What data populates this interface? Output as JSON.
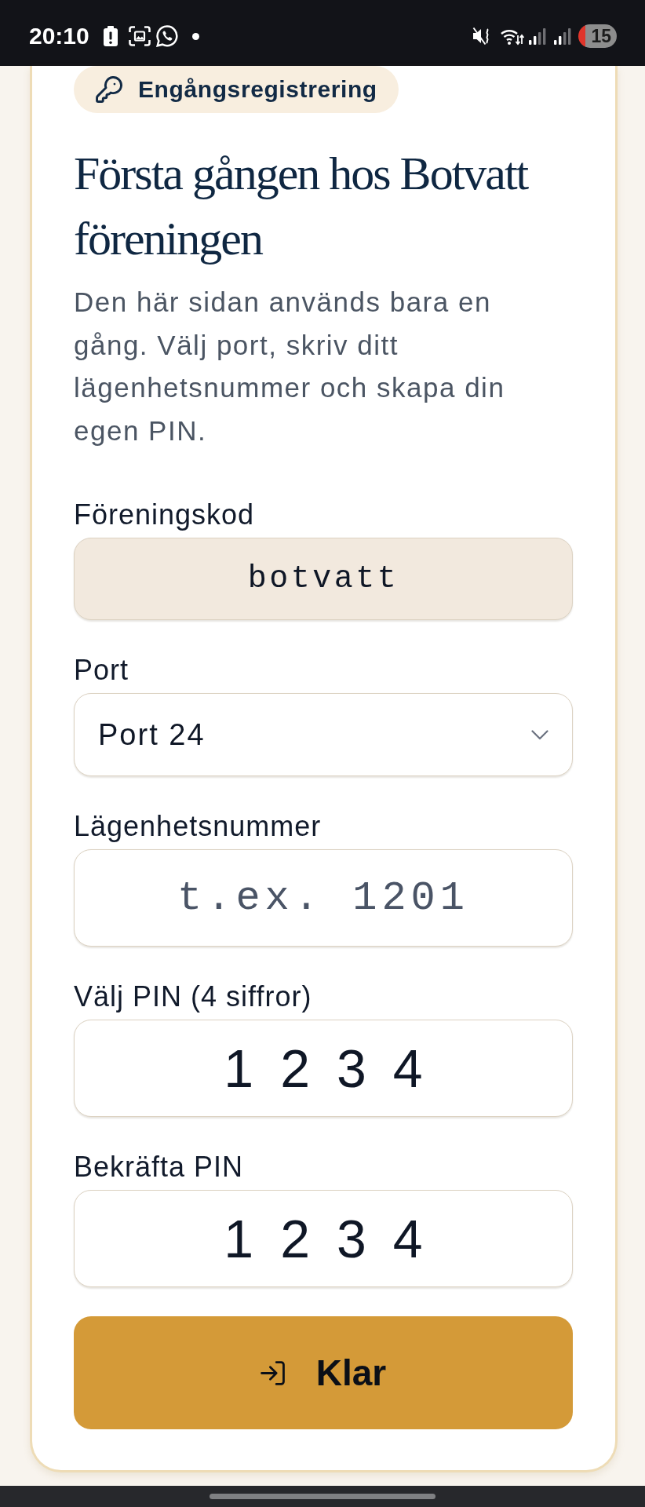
{
  "status_bar": {
    "time": "20:10",
    "battery": "15"
  },
  "card": {
    "badge": "Engångsregistrering",
    "title": "Första gången hos Botvatt föreningen",
    "description": "Den här sidan används bara en gång. Välj port, skriv ditt lägenhetsnummer och skapa din egen PIN.",
    "fields": [
      {
        "kind": "readonly",
        "label": "Föreningskod",
        "value": "botvatt"
      },
      {
        "kind": "select",
        "label": "Port",
        "value": "Port 24"
      },
      {
        "kind": "text",
        "label": "Lägenhetsnummer",
        "placeholder": "t.ex. 1201"
      },
      {
        "kind": "pin",
        "label": "Välj PIN (4 siffror)",
        "value": "1234"
      },
      {
        "kind": "pin",
        "label": "Bekräfta PIN",
        "value": "1234"
      }
    ],
    "submit_button": {
      "label": "Klar"
    }
  }
}
